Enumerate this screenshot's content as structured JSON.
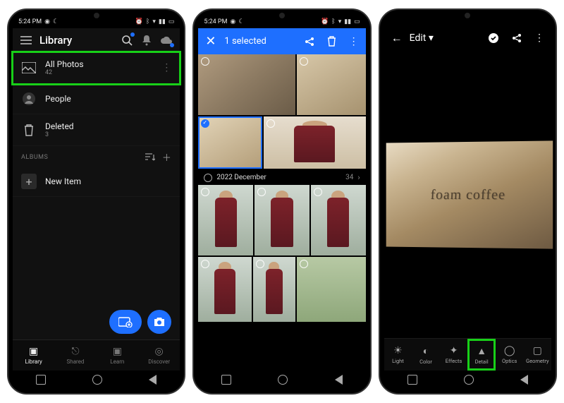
{
  "status": {
    "time": "5:24 PM"
  },
  "phone1": {
    "header": {
      "title": "Library"
    },
    "rows": {
      "allPhotos": {
        "title": "All Photos",
        "count": "42"
      },
      "people": {
        "title": "People"
      },
      "deleted": {
        "title": "Deleted",
        "count": "3"
      }
    },
    "albumsLabel": "ALBUMS",
    "newItem": "New Item",
    "bottomNav": {
      "library": "Library",
      "shared": "Shared",
      "learn": "Learn",
      "discover": "Discover"
    }
  },
  "phone2": {
    "header": {
      "selected": "1 selected"
    },
    "dateRow": {
      "label": "2022 December",
      "count": "34"
    }
  },
  "phone3": {
    "header": {
      "title": "Edit ▾"
    },
    "photoText": "foam coffee",
    "tools": {
      "light": "Light",
      "color": "Color",
      "effects": "Effects",
      "detail": "Detail",
      "optics": "Optics",
      "geometry": "Geometry"
    }
  }
}
